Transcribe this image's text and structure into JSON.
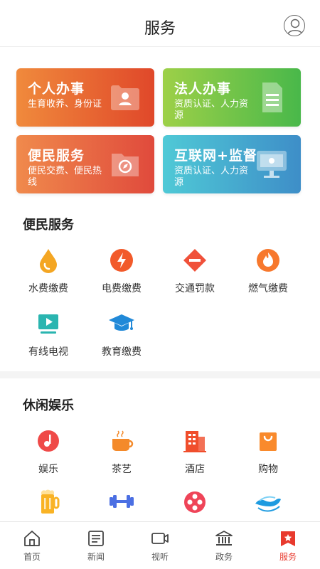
{
  "header": {
    "title": "服务",
    "profile_icon": "user-circle-icon"
  },
  "cards": [
    {
      "title": "个人办事",
      "subtitle": "生育收养、身份证",
      "icon": "id-card-icon",
      "colors": [
        "#f08a3c",
        "#e0482a"
      ]
    },
    {
      "title": "法人办事",
      "subtitle": "资质认证、人力资源",
      "icon": "document-icon",
      "colors": [
        "#9dd048",
        "#49b84a"
      ]
    },
    {
      "title": "便民服务",
      "subtitle": "便民交费、便民热线",
      "icon": "folder-icon",
      "colors": [
        "#f08a4c",
        "#e04a3c"
      ]
    },
    {
      "title": "互联网+监督",
      "subtitle": "资质认证、人力资源",
      "icon": "monitor-icon",
      "colors": [
        "#4fc9d6",
        "#3e8ec8"
      ]
    }
  ],
  "convenience": {
    "title": "便民服务",
    "items": [
      {
        "label": "水费缴费",
        "icon": "water-drop-icon"
      },
      {
        "label": "电费缴费",
        "icon": "lightning-icon"
      },
      {
        "label": "交通罚款",
        "icon": "no-entry-icon"
      },
      {
        "label": "燃气缴费",
        "icon": "flame-icon"
      },
      {
        "label": "有线电视",
        "icon": "tv-icon"
      },
      {
        "label": "教育缴费",
        "icon": "graduation-cap-icon"
      }
    ]
  },
  "leisure": {
    "title": "休闲娱乐",
    "items": [
      {
        "label": "娱乐",
        "icon": "music-note-icon"
      },
      {
        "label": "茶艺",
        "icon": "tea-cup-icon"
      },
      {
        "label": "酒店",
        "icon": "hotel-building-icon"
      },
      {
        "label": "购物",
        "icon": "shopping-bag-icon"
      },
      {
        "label": "",
        "icon": "beer-mug-icon"
      },
      {
        "label": "",
        "icon": "dumbbell-icon"
      },
      {
        "label": "",
        "icon": "film-reel-icon"
      },
      {
        "label": "",
        "icon": "swimming-icon"
      }
    ]
  },
  "tabbar": {
    "active_color": "#e83a2e",
    "tabs": [
      {
        "label": "首页",
        "icon": "home-icon"
      },
      {
        "label": "新闻",
        "icon": "news-icon"
      },
      {
        "label": "视听",
        "icon": "video-icon"
      },
      {
        "label": "政务",
        "icon": "government-icon"
      },
      {
        "label": "服务",
        "icon": "service-bookmark-icon",
        "active": true
      }
    ]
  }
}
